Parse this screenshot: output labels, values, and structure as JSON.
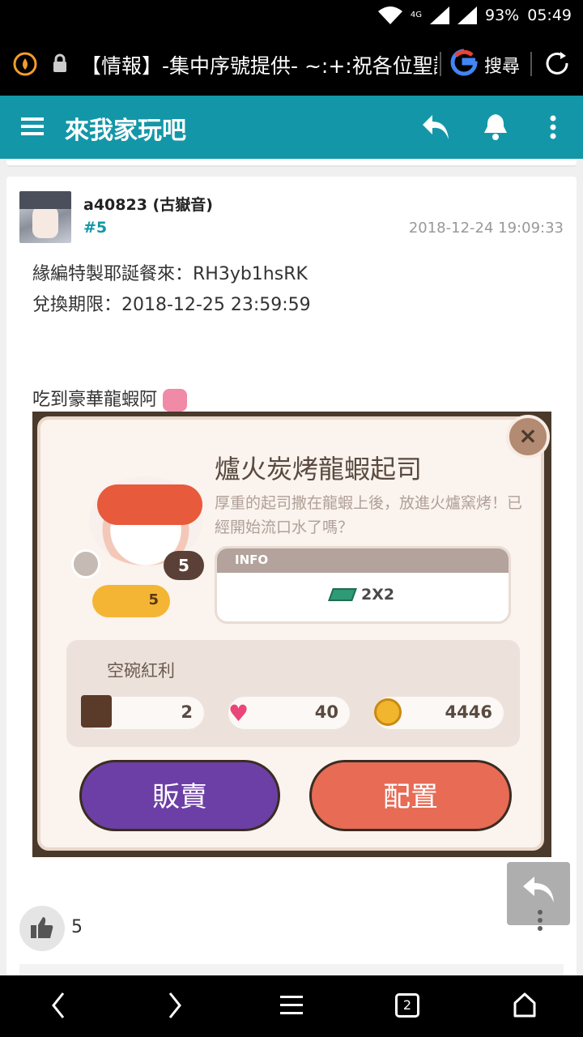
{
  "status_bar": {
    "battery": "93%",
    "time": "05:49",
    "network_label": "4G"
  },
  "browser": {
    "url_text": "【情報】-集中序號提供- ~:+:祝各位聖誕",
    "search_label": "搜尋"
  },
  "app_bar": {
    "title": "來我家玩吧"
  },
  "post": {
    "username": "a40823 (古嶽音)",
    "floor": "#5",
    "timestamp": "2018-12-24 19:09:33",
    "lines": [
      "緣編特製耶誕餐來：RH3yb1hsRK",
      "兌換期限：2018-12-25 23:59:59",
      "吃到豪華龍蝦阿"
    ],
    "likes": "5"
  },
  "game": {
    "title": "爐火炭烤龍蝦起司",
    "description": "厚重的起司撒在龍蝦上後，放進火爐窯烤！已經開始流口水了嗎？",
    "info_label": "INFO",
    "size": "2X2",
    "level": "5",
    "chef_count": "5",
    "bonus_title": "空碗紅利",
    "bonus_values": [
      "2",
      "40",
      "4446"
    ],
    "sell_label": "販賣",
    "place_label": "配置",
    "close": "×"
  },
  "bottom_nav": {
    "tabs": "2"
  },
  "colors": {
    "accent": "#1397a8",
    "sell": "#6c3fa6",
    "place": "#e76b55"
  }
}
